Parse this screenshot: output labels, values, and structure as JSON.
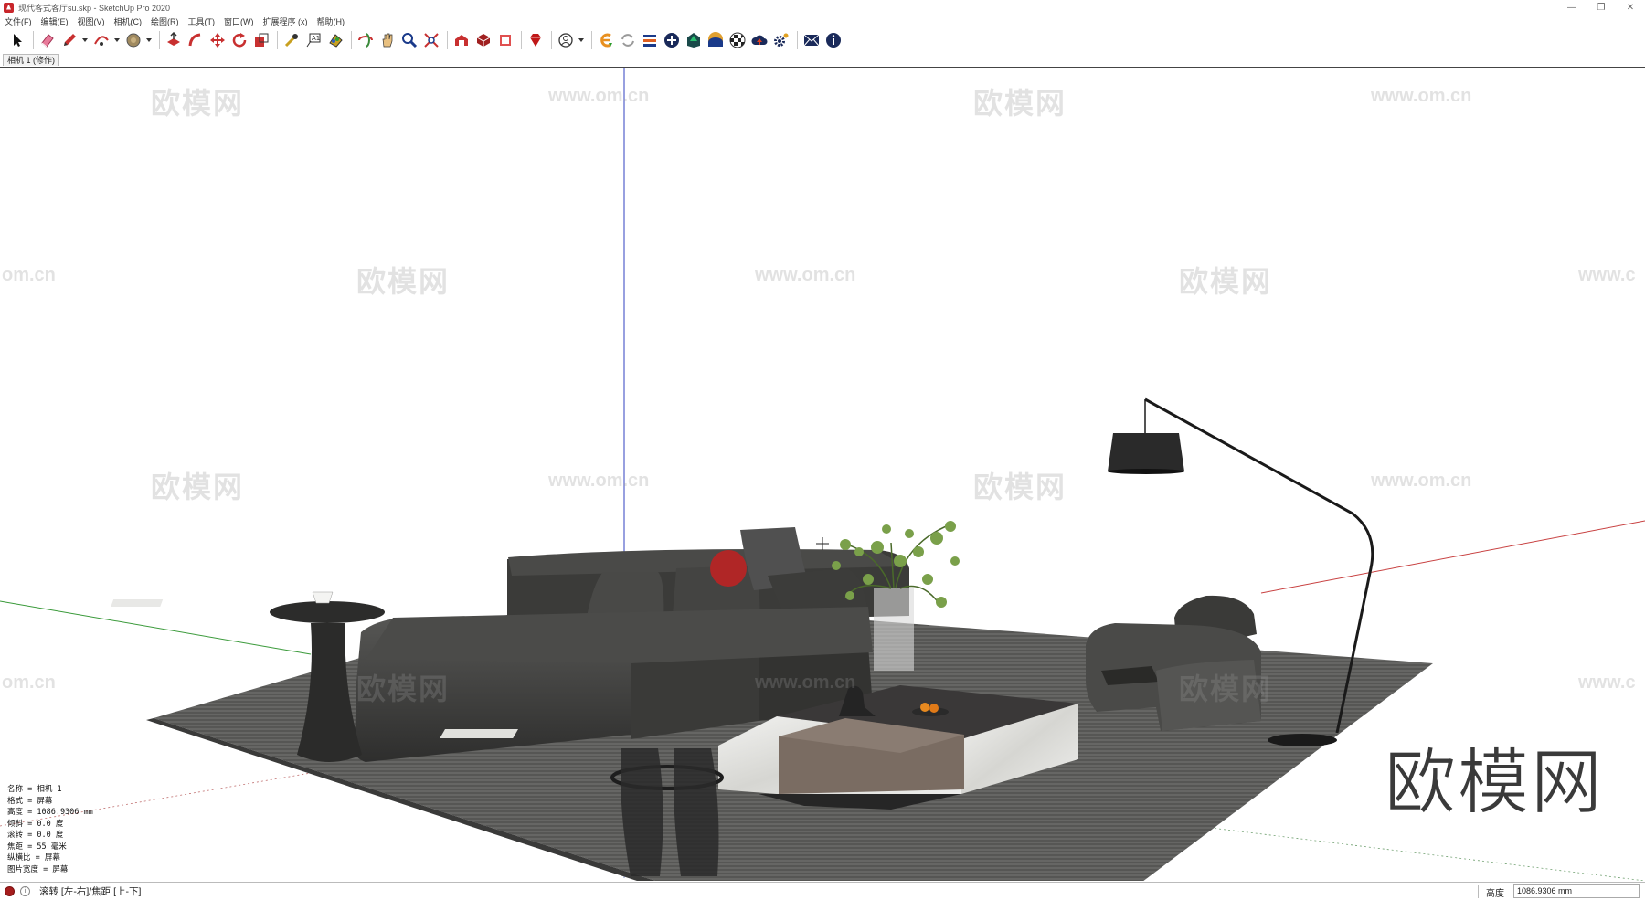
{
  "window": {
    "title": "现代客式客厅su.skp - SketchUp Pro 2020",
    "min": "—",
    "max": "❐",
    "close": "✕"
  },
  "menu": [
    "文件(F)",
    "编辑(E)",
    "视图(V)",
    "相机(C)",
    "绘图(R)",
    "工具(T)",
    "窗口(W)",
    "扩展程序 (x)",
    "帮助(H)"
  ],
  "scene_tab": "相机 1 (修作)",
  "toolbar_icons": [
    "select-icon",
    "eraser-icon",
    "pencil-icon",
    "arc-icon",
    "shape-icon",
    "push-pull-icon",
    "follow-me-icon",
    "move-icon",
    "rotate-icon",
    "scale-icon",
    "tape-icon",
    "text-icon",
    "paint-icon",
    "orbit-icon",
    "pan-icon",
    "zoom-icon",
    "zoom-extents-icon",
    "warehouse-icon",
    "extension-warehouse-icon",
    "layout-icon",
    "ruby-icon",
    "account-icon",
    "plugin-e-icon",
    "refresh-icon",
    "layers-icon",
    "add-icon",
    "house-icon",
    "materials-icon",
    "checker-icon",
    "cloud-upload-icon",
    "settings-icon",
    "mail-icon",
    "info-icon"
  ],
  "watermarks": {
    "cn": "欧模网",
    "url": "www.om.cn",
    "partial_left": "om.cn",
    "partial_right": "www.c"
  },
  "logo": "欧模网",
  "camera_info": [
    "名称 = 相机 1",
    "格式 = 屏幕",
    "高度 = 1086.9306 mm",
    "倾斜 = 0.0 度",
    "滚转 = 0.0 度",
    "焦距 = 55 毫米",
    "纵横比 = 屏幕",
    "图片宽度 = 屏幕"
  ],
  "status": {
    "hint": "滚转 [左-右]/焦距 [上-下]",
    "measure_label": "高度",
    "measure_value": "1086.9306 mm"
  },
  "colors": {
    "accent_red": "#c8262b",
    "axis_green": "#3a9a3a",
    "axis_red": "#c84040",
    "axis_blue": "#3040c0",
    "sofa": "#3d3d3b",
    "rug": "#5a5a58"
  }
}
